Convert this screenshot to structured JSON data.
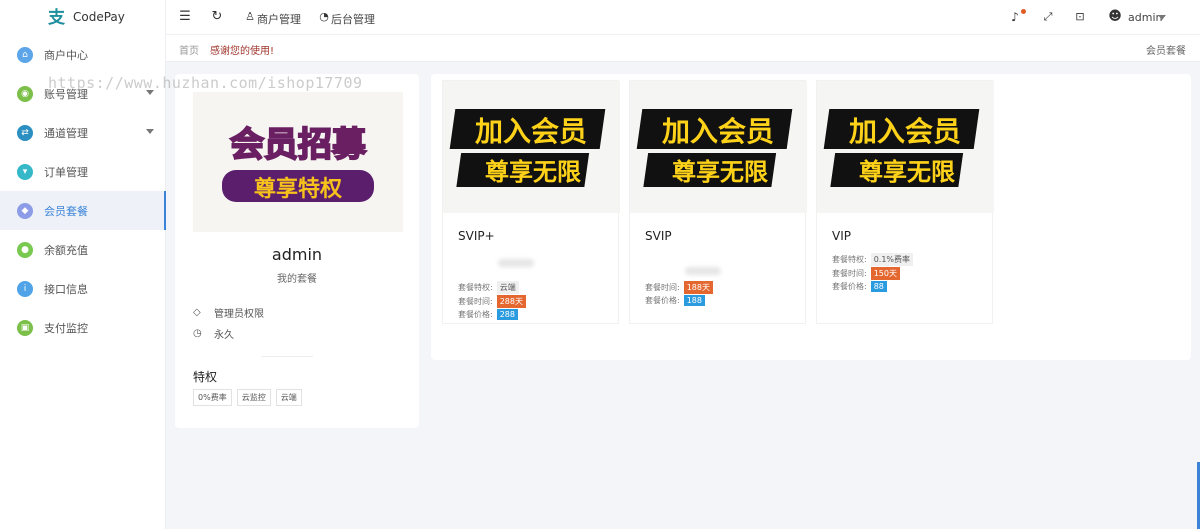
{
  "app": {
    "name": "CodePay",
    "logo_glyph": "支"
  },
  "sidebar": {
    "items": [
      {
        "label": "商户中心",
        "icon": "home-icon",
        "color": "#5ba5e8"
      },
      {
        "label": "账号管理",
        "icon": "user-icon",
        "color": "#7cc04a",
        "caret": true
      },
      {
        "label": "通道管理",
        "icon": "channel-icon",
        "color": "#2b8fc2",
        "caret": true
      },
      {
        "label": "订单管理",
        "icon": "cart-icon",
        "color": "#35b8c8"
      },
      {
        "label": "会员套餐",
        "icon": "diamond-icon",
        "color": "#8d9ce6",
        "active": true
      },
      {
        "label": "余额充值",
        "icon": "recharge-icon",
        "color": "#79c950"
      },
      {
        "label": "接口信息",
        "icon": "info-icon",
        "color": "#4fa3e6"
      },
      {
        "label": "支付监控",
        "icon": "monitor-icon",
        "color": "#7cc04a"
      }
    ]
  },
  "topbar": {
    "nav1": "商户管理",
    "nav2": "后台管理",
    "user": "admin"
  },
  "breadcrumb": {
    "home": "首页",
    "current": "感谢您的使用!",
    "right": "会员套餐"
  },
  "watermark": "https://www.huzhan.com/ishop17709",
  "profile": {
    "banner_line1": "会员招募",
    "banner_line2": "尊享特权",
    "name": "admin",
    "subtitle": "我的套餐",
    "role": "管理员权限",
    "duration": "永久",
    "privileges_title": "特权",
    "tags": [
      "0%费率",
      "云监控",
      "云端"
    ]
  },
  "plans": [
    {
      "img_line1": "加入会员",
      "img_line2": "尊享无限",
      "title": "SVIP+",
      "feature_label": "套餐特权:",
      "feature_value": "云端",
      "time_label": "套餐时间:",
      "time_value": "288天",
      "price_label": "套餐价格:",
      "price_value": "288"
    },
    {
      "img_line1": "加入会员",
      "img_line2": "尊享无限",
      "title": "SVIP",
      "time_label": "套餐时间:",
      "time_value": "188天",
      "price_label": "套餐价格:",
      "price_value": "188"
    },
    {
      "img_line1": "加入会员",
      "img_line2": "尊享无限",
      "title": "VIP",
      "feature_label": "套餐特权:",
      "feature_value": "0.1%费率",
      "time_label": "套餐时间:",
      "time_value": "150天",
      "price_label": "套餐价格:",
      "price_value": "88"
    }
  ],
  "colors": {
    "accent": "#3c84d8",
    "badge_red": "#e3672f",
    "badge_blue": "#2b9be0"
  }
}
